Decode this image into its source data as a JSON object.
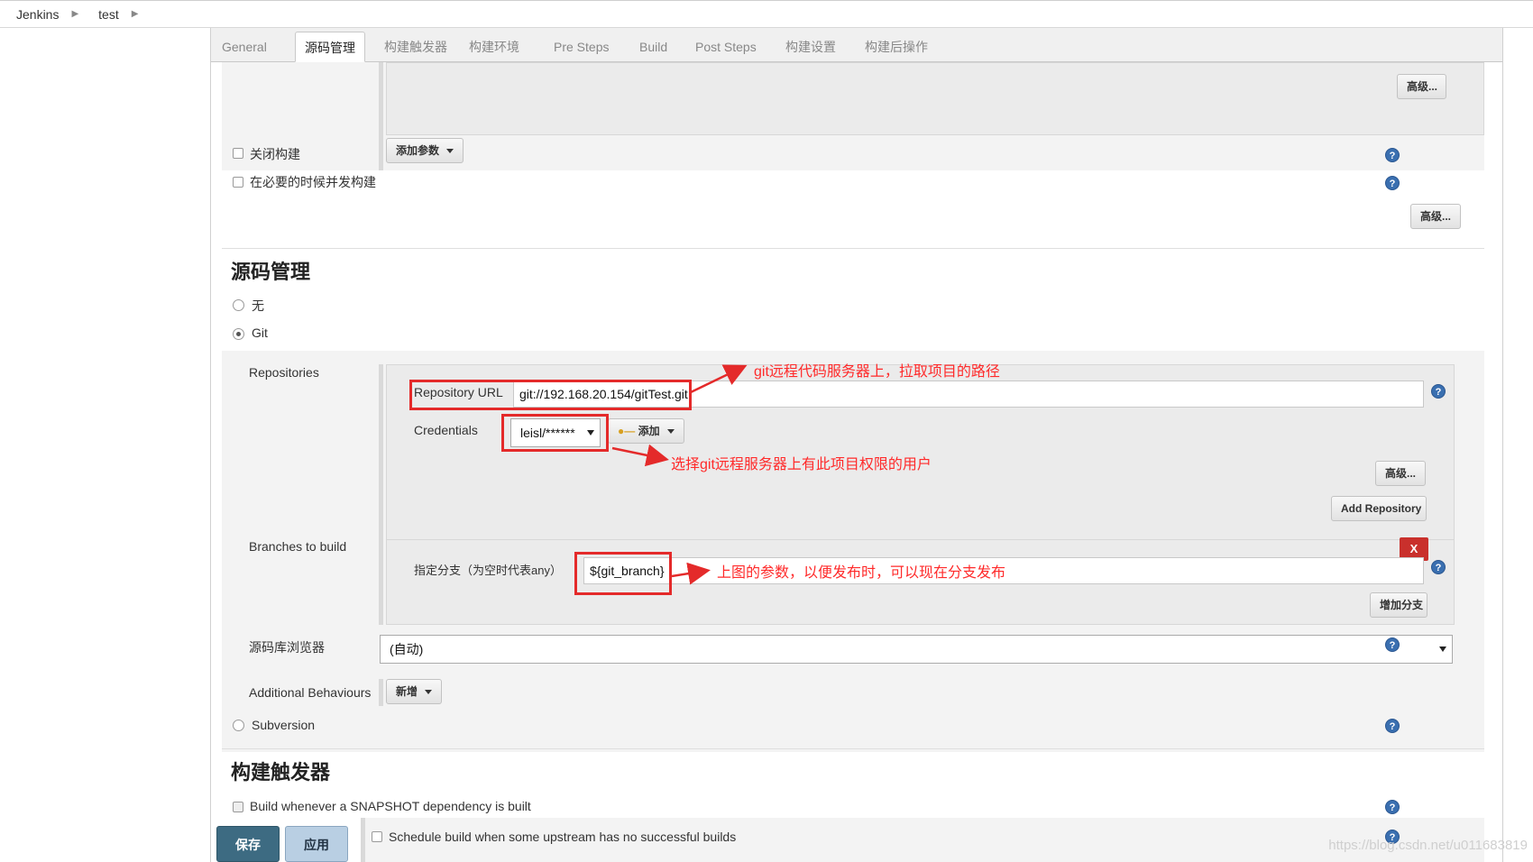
{
  "breadcrumb": {
    "items": [
      "Jenkins",
      "test"
    ]
  },
  "tabs": [
    "General",
    "源码管理",
    "构建触发器",
    "构建环境",
    "Pre Steps",
    "Build",
    "Post Steps",
    "构建设置",
    "构建后操作"
  ],
  "top": {
    "advanced_label": "高级...",
    "add_param_label": "添加参数",
    "disable_build_label": "关闭构建",
    "concurrent_build_label": "在必要的时候并发构建",
    "advanced2_label": "高级..."
  },
  "scm": {
    "title": "源码管理",
    "none_label": "无",
    "git_label": "Git",
    "repositories_label": "Repositories",
    "repo_url_label": "Repository URL",
    "repo_url_value": "git://192.168.20.154/gitTest.git",
    "credentials_label": "Credentials",
    "credentials_value": "leisl/******",
    "add_cred_label": "添加",
    "repo_advanced_label": "高级...",
    "add_repository_label": "Add Repository",
    "branches_label": "Branches to build",
    "branch_spec_label": "指定分支（为空时代表any）",
    "branch_value": "${git_branch}",
    "remove_label": "X",
    "add_branch_label": "增加分支",
    "browser_label": "源码库浏览器",
    "browser_value": "(自动)",
    "behaviours_label": "Additional Behaviours",
    "new_label": "新增",
    "subversion_label": "Subversion"
  },
  "triggers": {
    "title": "构建触发器",
    "snapshot_label": "Build whenever a SNAPSHOT dependency is built",
    "upstream_label": "Schedule build when some upstream has no successful builds"
  },
  "annotations": {
    "repo_url": "git远程代码服务器上，拉取项目的路径",
    "credentials": "选择git远程服务器上有此项目权限的用户",
    "branch": "上图的参数，以便发布时，可以现在分支发布"
  },
  "footer": {
    "save_label": "保存",
    "apply_label": "应用"
  },
  "watermark": "https://blog.csdn.net/u011683819",
  "colors": {
    "annotation": "#ff2a2a",
    "save_button": "#3d6b82",
    "apply_button": "#b9cfe3",
    "help_icon": "#3a6fb0"
  }
}
